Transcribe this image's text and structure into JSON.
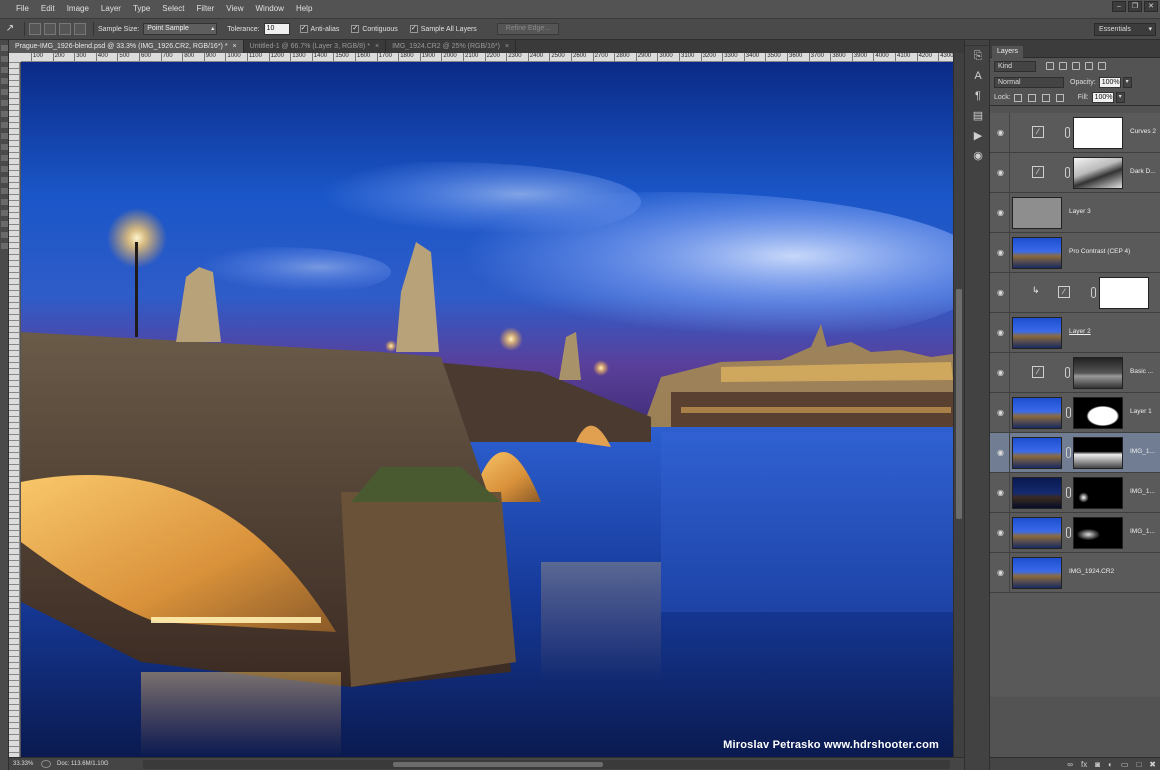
{
  "menu": [
    "File",
    "Edit",
    "Image",
    "Layer",
    "Type",
    "Select",
    "Filter",
    "View",
    "Window",
    "Help"
  ],
  "window_controls": [
    "–",
    "❐",
    "✕"
  ],
  "options": {
    "tool_icon": "eyedropper-icon",
    "sample_size_label": "Sample Size:",
    "sample_size_value": "Point Sample",
    "tolerance_label": "Tolerance:",
    "tolerance_value": "10",
    "anti_alias": "Anti-alias",
    "contiguous": "Contiguous",
    "sample_all_layers": "Sample All Layers",
    "refine_edge": "Refine Edge...",
    "workspace": "Essentials"
  },
  "doc_tabs": [
    {
      "label": "Prague-IMG_1926-blend.psd @ 33.3% (IMG_1926.CR2, RGB/16*) *",
      "active": true
    },
    {
      "label": "Untitled-1 @ 66.7% (Layer 3, RGB/8) *",
      "active": false
    },
    {
      "label": "IMG_1924.CR2 @ 25% (RGB/16*)",
      "active": false
    }
  ],
  "ruler_labels": [
    "100",
    "200",
    "300",
    "400",
    "500",
    "600",
    "700",
    "800",
    "900",
    "1000",
    "1100",
    "1200",
    "1300",
    "1400",
    "1500",
    "1600",
    "1700",
    "1800",
    "1900",
    "2000",
    "2100",
    "2200",
    "2300",
    "2400",
    "2500",
    "2600",
    "2700",
    "2800",
    "2900",
    "3000",
    "3100",
    "3200",
    "3300",
    "3400",
    "3500",
    "3600",
    "3700",
    "3800",
    "3900",
    "4000",
    "4100",
    "4200",
    "4300"
  ],
  "canvas": {
    "watermark": "Miroslav  Petrasko  www.hdrshooter.com"
  },
  "status": {
    "zoom": "33.33%",
    "doc_size": "Doc: 113.6M/1.10G"
  },
  "icon_strip": [
    "history-icon",
    "character-icon",
    "paragraph-icon",
    "tool-presets-icon",
    "actions-icon",
    "3d-icon"
  ],
  "layers_panel": {
    "tab": "Layers",
    "kind": "Kind",
    "blend_mode": "Normal",
    "opacity_label": "Opacity:",
    "opacity_value": "100%",
    "lock_label": "Lock:",
    "fill_label": "Fill:",
    "fill_value": "100%",
    "layers": [
      {
        "name": "Curves 2",
        "type": "adjustment",
        "mask": "white"
      },
      {
        "name": "Dark D...",
        "type": "adjustment",
        "mask": "dark-detail"
      },
      {
        "name": "Layer 3",
        "type": "gray"
      },
      {
        "name": "Pro Contrast (CEP 4)",
        "type": "photo"
      },
      {
        "name": "",
        "type": "clipped-adjustment",
        "mask": "white"
      },
      {
        "name": "Layer 2",
        "type": "photo",
        "underline": true
      },
      {
        "name": "Basic ...",
        "type": "adjustment",
        "mask": "basic"
      },
      {
        "name": "Layer 1",
        "type": "photo",
        "mask": "layer1"
      },
      {
        "name": "IMG_1...",
        "type": "photo",
        "mask": "img1",
        "selected": true
      },
      {
        "name": "IMG_1...",
        "type": "photo-dark",
        "mask": "sparse"
      },
      {
        "name": "IMG_1...",
        "type": "photo",
        "mask": "sparse2"
      },
      {
        "name": "IMG_1924.CR2",
        "type": "photo"
      }
    ],
    "footer_icons": [
      "link-icon",
      "fx-icon",
      "mask-icon",
      "adjustment-icon",
      "folder-icon",
      "new-layer-icon",
      "trash-icon"
    ]
  }
}
